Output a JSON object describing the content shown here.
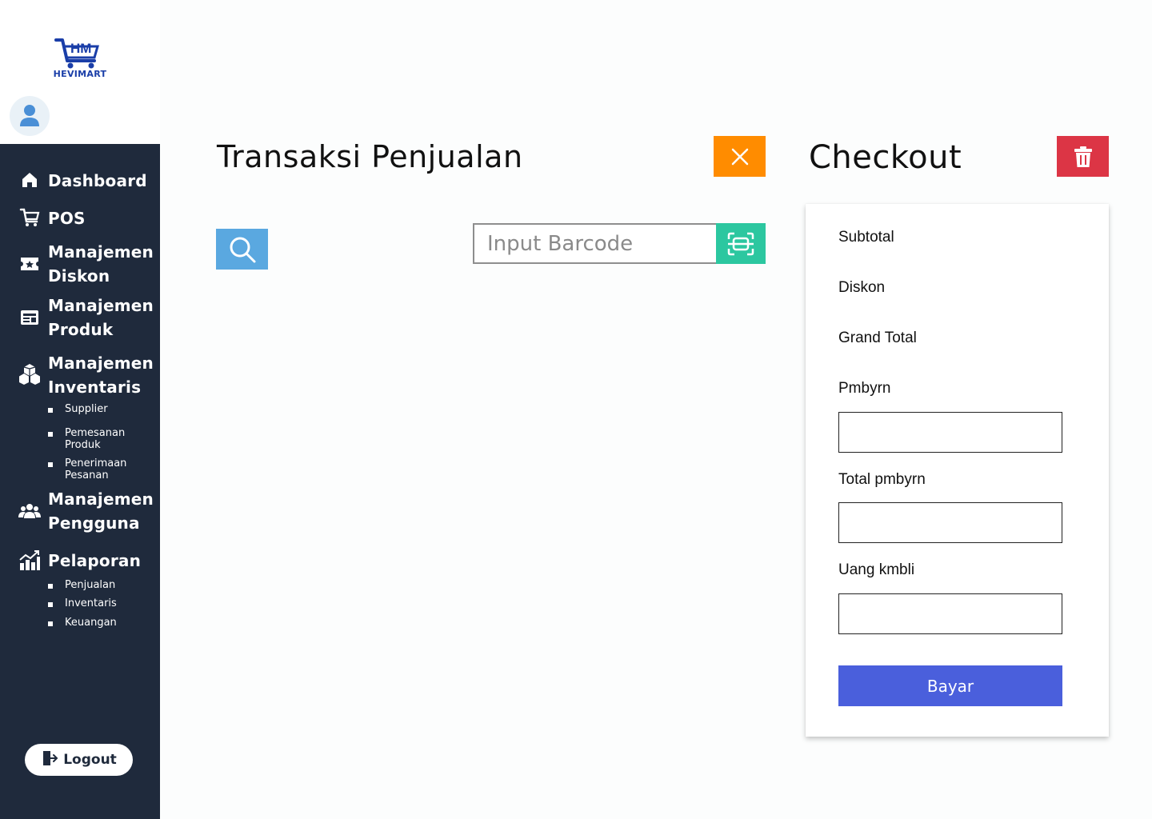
{
  "brand": {
    "name": "HEVIMART",
    "logo_letters": "HM",
    "accent": "#1a3ea8"
  },
  "sidebar": {
    "background": "#1f2a3c",
    "items": [
      {
        "label": "Dashboard",
        "icon": "home-icon"
      },
      {
        "label": "POS",
        "icon": "cart-icon"
      },
      {
        "label": "Manajemen Diskon",
        "icon": "ticket-icon"
      },
      {
        "label": "Manajemen Produk",
        "icon": "product-card-icon"
      },
      {
        "label": "Manajemen Inventaris",
        "icon": "boxes-icon",
        "subitems": [
          "Supplier",
          "Pemesanan Produk",
          "Penerimaan Pesanan"
        ]
      },
      {
        "label": "Manajemen Pengguna",
        "icon": "users-icon"
      },
      {
        "label": "Pelaporan",
        "icon": "chart-icon",
        "subitems": [
          "Penjualan",
          "Inventaris",
          "Keuangan"
        ]
      }
    ],
    "logout_label": "Logout"
  },
  "main": {
    "title": "Transaksi Penjualan",
    "barcode_placeholder": "Input Barcode",
    "close_color": "#ff8c00",
    "search_color": "#5aa8e0",
    "scan_color": "#2cc7a0"
  },
  "checkout": {
    "title": "Checkout",
    "subtotal_label": "Subtotal",
    "diskon_label": "Diskon",
    "grand_total_label": "Grand Total",
    "payment_label": "Pmbyrn",
    "total_payment_label": "Total pmbyrn",
    "change_label": "Uang kmbli",
    "pay_button": "Bayar",
    "pay_color": "#4a5fdc",
    "trash_color": "#dc3545"
  }
}
